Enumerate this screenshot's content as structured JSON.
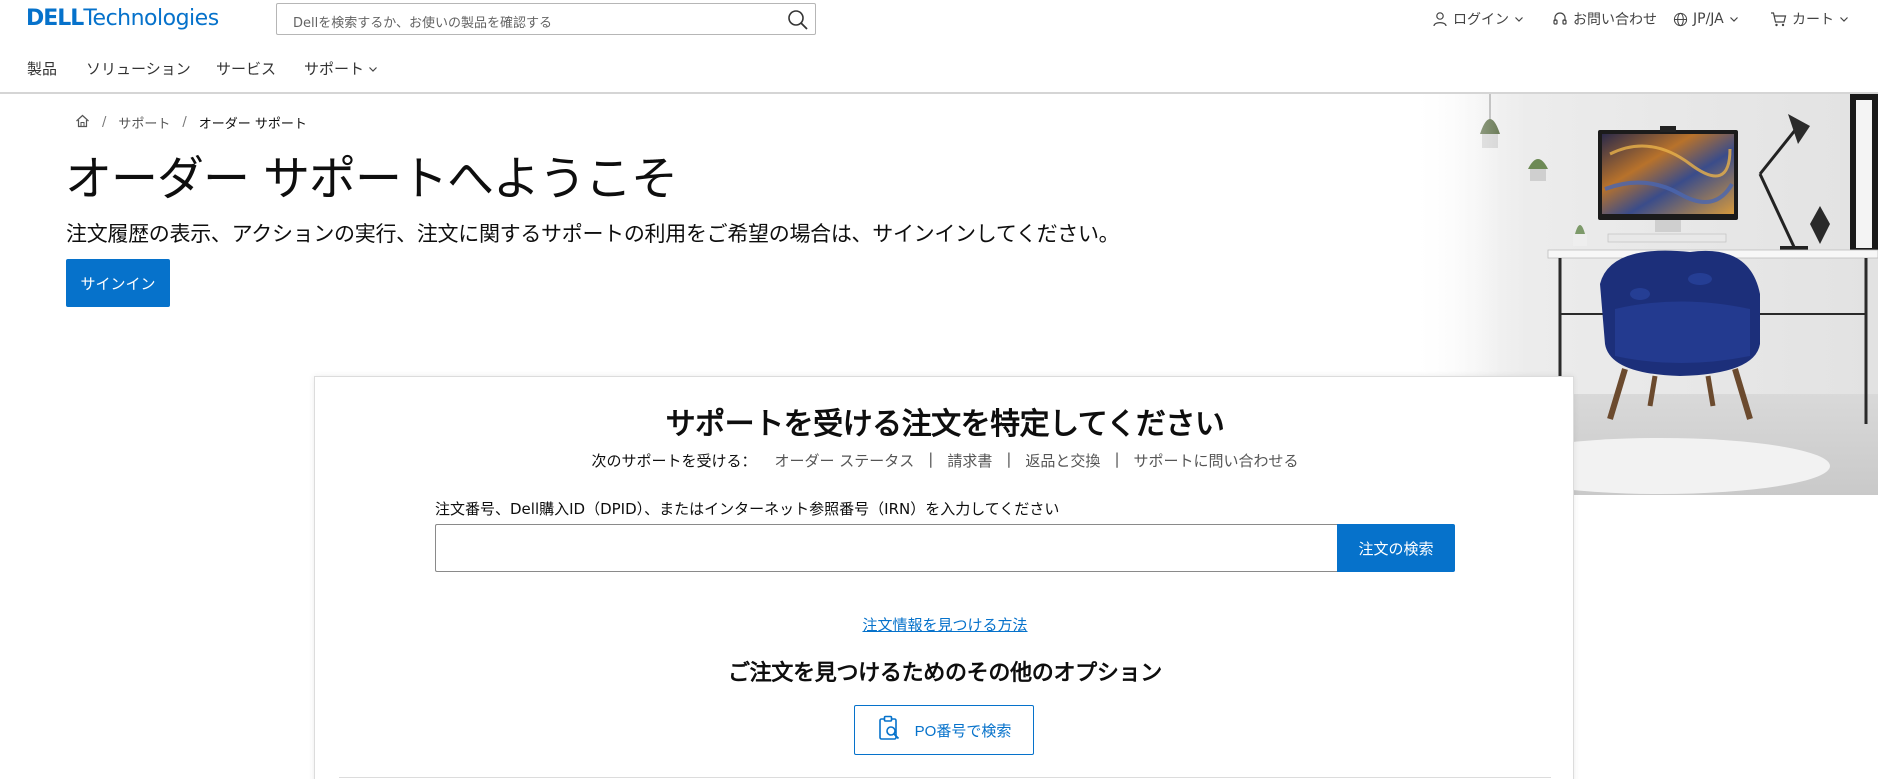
{
  "header": {
    "logo_bold": "DELL",
    "logo_light": "Technologies",
    "search_placeholder": "Dellを検索するか、お使いの製品を確認する",
    "login": "ログイン",
    "contact": "お問い合わせ",
    "locale": "JP/JA",
    "cart": "カート"
  },
  "nav": {
    "items": [
      "製品",
      "ソリューション",
      "サービス",
      "サポート"
    ]
  },
  "breadcrumb": {
    "items": [
      "サポート",
      "オーダー サポート"
    ]
  },
  "hero": {
    "title": "オーダー サポートへようこそ",
    "subtitle": "注文履歴の表示、アクションの実行、注文に関するサポートの利用をご希望の場合は、サインインしてください。",
    "signin_button": "サインイン"
  },
  "order_card": {
    "title": "サポートを受ける注文を特定してください",
    "links_lead": "次のサポートを受ける：",
    "links": [
      "オーダー ステータス",
      "請求書",
      "返品と交換",
      "サポートに問い合わせる"
    ],
    "field_label": "注文番号、Dell購入ID（DPID）、またはインターネット参照番号（IRN）を入力してください",
    "input_value": "",
    "find_button": "注文の検索",
    "how_link": "注文情報を見つける方法",
    "options_title": "ご注文を見つけるためのその他のオプション",
    "po_button": "PO番号で検索"
  },
  "colors": {
    "accent": "#0672cb",
    "text": "#0e0e0e",
    "muted": "#555555",
    "chair": "#1c2f7a"
  },
  "icons": [
    "search-icon",
    "user-icon",
    "chevron-down-icon",
    "headset-icon",
    "globe-icon",
    "cart-icon",
    "home-icon",
    "clipboard-search-icon"
  ]
}
